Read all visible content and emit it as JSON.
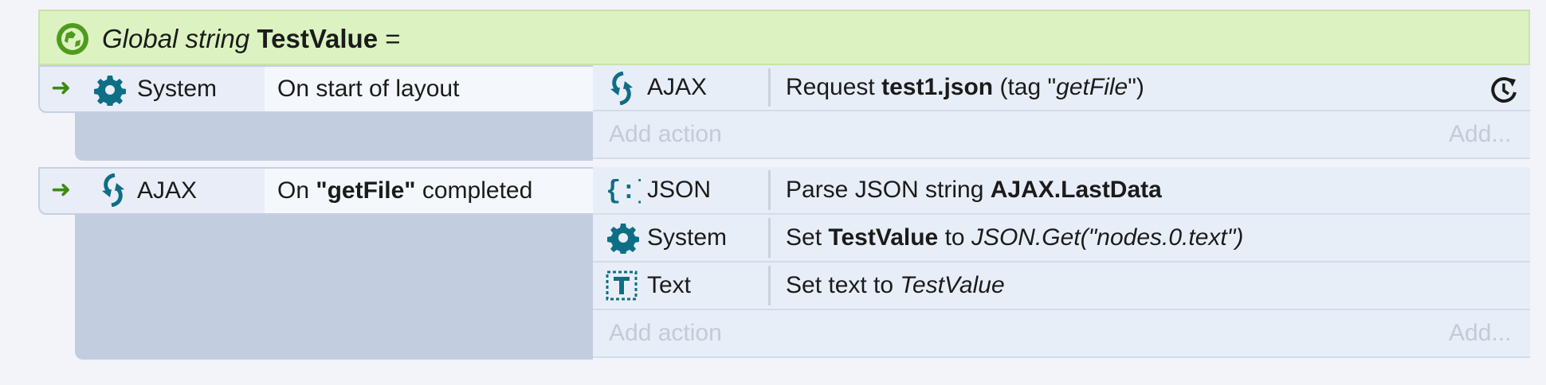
{
  "global": {
    "prefix": "Global string",
    "name": "TestValue",
    "suffix": "="
  },
  "events": [
    {
      "object": "System",
      "condition": "On start of layout",
      "actions": [
        {
          "object": "AJAX",
          "prefix": "Request",
          "bold": "test1.json",
          "tag_open": "(tag \"",
          "tag_italic": "getFile",
          "tag_close": "\")"
        }
      ],
      "add_action": "Add action",
      "add_more": "Add..."
    },
    {
      "object": "AJAX",
      "cond_prefix": "On",
      "cond_bold": "\"getFile\"",
      "cond_suffix": "completed",
      "actions": [
        {
          "object": "JSON",
          "prefix": "Parse JSON string",
          "bold": "AJAX.LastData"
        },
        {
          "object": "System",
          "prefix": "Set",
          "bold": "TestValue",
          "middle": "to",
          "italic": "JSON.Get(\"nodes.0.text\")"
        },
        {
          "object": "Text",
          "prefix": "Set text to",
          "italic": "TestValue"
        }
      ],
      "add_action": "Add action",
      "add_more": "Add..."
    }
  ],
  "colors": {
    "global_bg": "#dcf3c1",
    "icon_teal": "#0e6e86",
    "arrow_green": "#3d8a14"
  },
  "icons": [
    "globe-icon",
    "gear-icon",
    "ajax-icon",
    "json-icon",
    "text-icon",
    "refresh-icon",
    "arrow-right-icon"
  ]
}
